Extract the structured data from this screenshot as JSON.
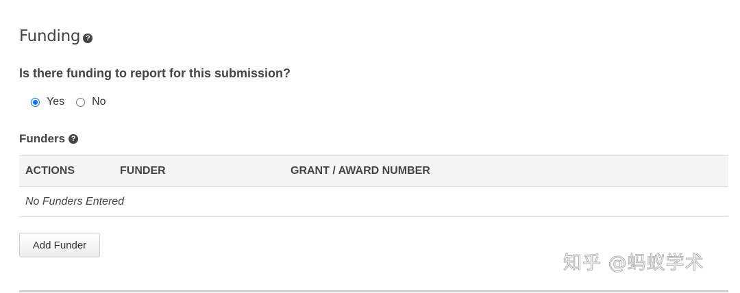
{
  "section": {
    "title": "Funding",
    "help_icon": "question-circle"
  },
  "question": {
    "text": "Is there funding to report for this submission?",
    "options": [
      {
        "label": "Yes",
        "checked": true
      },
      {
        "label": "No",
        "checked": false
      }
    ]
  },
  "funders": {
    "heading": "Funders",
    "help_icon": "question-circle",
    "columns": [
      "ACTIONS",
      "FUNDER",
      "GRANT / AWARD NUMBER"
    ],
    "empty_text": "No Funders Entered",
    "add_button_label": "Add Funder"
  },
  "watermark": {
    "text": "知乎 @蚂蚁学术"
  },
  "colors": {
    "radio_accent": "#0075ff",
    "header_bg": "#f5f5f5",
    "border": "#dddddd"
  }
}
